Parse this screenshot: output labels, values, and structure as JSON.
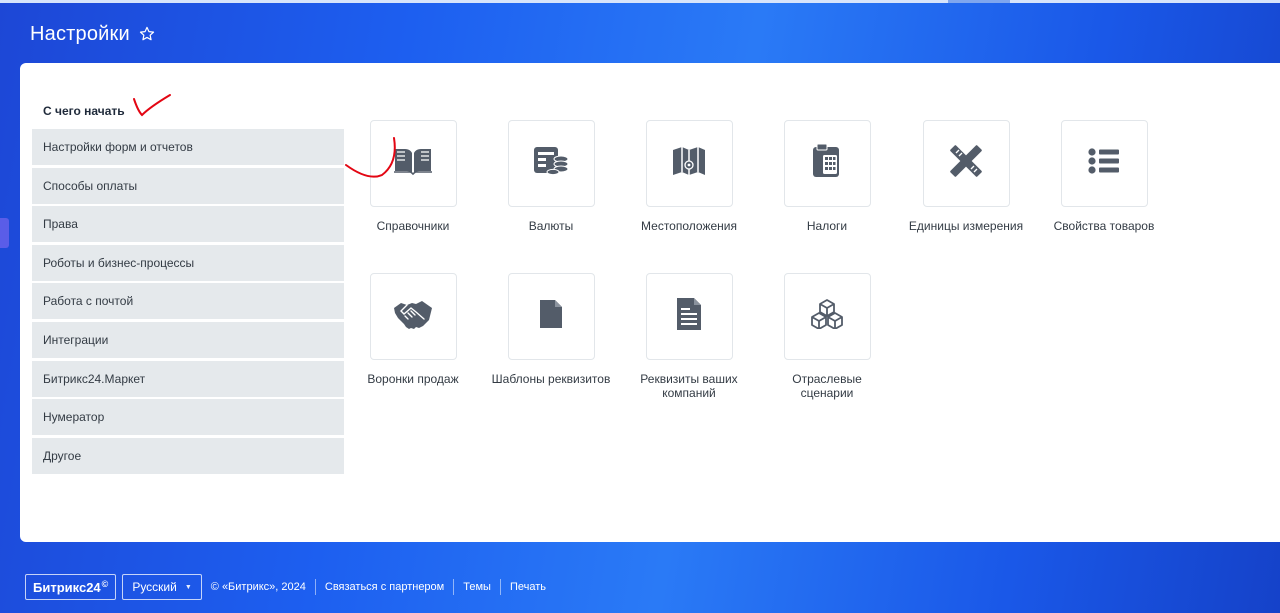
{
  "header": {
    "title": "Настройки",
    "star_icon": "star-outline-icon"
  },
  "sidebar": {
    "first_item": "С чего начать",
    "items": [
      {
        "label": "Настройки форм и отчетов"
      },
      {
        "label": "Способы оплаты"
      },
      {
        "label": "Права"
      },
      {
        "label": "Роботы и бизнес-процессы"
      },
      {
        "label": "Работа с почтой"
      },
      {
        "label": "Интеграции"
      },
      {
        "label": "Битрикс24.Маркет"
      },
      {
        "label": "Нумератор"
      },
      {
        "label": "Другое"
      }
    ]
  },
  "tiles": [
    {
      "label": "Справочники",
      "icon": "book-icon"
    },
    {
      "label": "Валюты",
      "icon": "coins-icon"
    },
    {
      "label": "Местоположения",
      "icon": "map-icon"
    },
    {
      "label": "Налоги",
      "icon": "calculator-icon"
    },
    {
      "label": "Единицы измерения",
      "icon": "ruler-pencil-icon"
    },
    {
      "label": "Свойства товаров",
      "icon": "list-icon"
    },
    {
      "label": "Воронки продаж",
      "icon": "handshake-icon"
    },
    {
      "label": "Шаблоны реквизитов",
      "icon": "file-icon"
    },
    {
      "label": "Реквизиты ваших компаний",
      "icon": "document-icon"
    },
    {
      "label": "Отраслевые сценарии",
      "icon": "cubes-icon"
    }
  ],
  "footer": {
    "brand": "Битрикс24",
    "brand_mark": "©",
    "language": "Русский",
    "copyright": "© «Битрикс», 2024",
    "links": [
      "Связаться с партнером",
      "Темы",
      "Печать"
    ]
  },
  "colors": {
    "icon": "#535c69",
    "panel": "#ffffff",
    "menu_item_bg": "#e5e9ec",
    "annotation": "#e30613"
  }
}
